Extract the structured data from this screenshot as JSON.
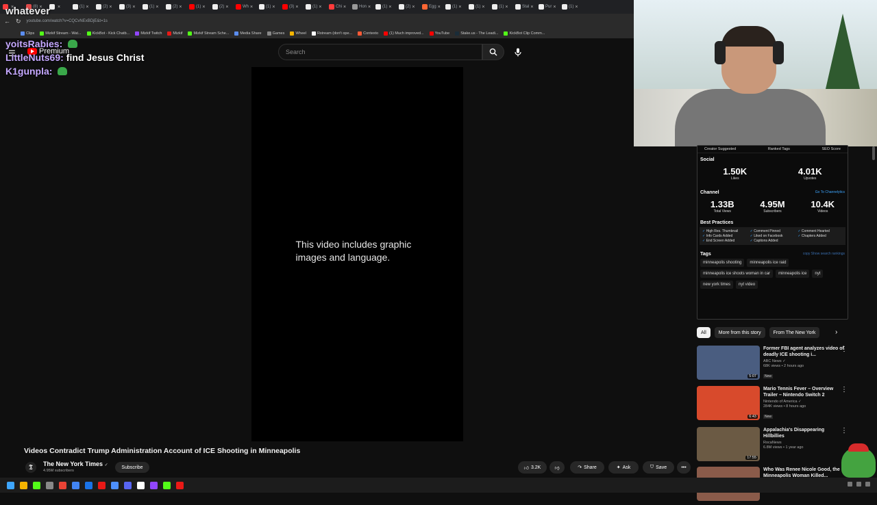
{
  "browser": {
    "tabs": [
      {
        "label": "",
        "color": "#ff3b3b"
      },
      {
        "label": "(8)",
        "color": "#e04a4a"
      },
      {
        "label": "",
        "color": "#eeeeee"
      },
      {
        "label": "(1)",
        "color": "#eeeeee"
      },
      {
        "label": "(2)",
        "color": "#eeeeee"
      },
      {
        "label": "(3)",
        "color": "#eeeeee"
      },
      {
        "label": "(1)",
        "color": "#eeeeee"
      },
      {
        "label": "(2)",
        "color": "#eeeeee"
      },
      {
        "label": "(1)",
        "color": "#ff0000"
      },
      {
        "label": "(2)",
        "color": "#eeeeee"
      },
      {
        "label": "Wh",
        "color": "#ff0000"
      },
      {
        "label": "(1)",
        "color": "#eeeeee"
      },
      {
        "label": "(3)",
        "color": "#ff0000"
      },
      {
        "label": "(1)",
        "color": "#eeeeee"
      },
      {
        "label": "Chi",
        "color": "#ff3b3b"
      },
      {
        "label": "Hon",
        "color": "#999999"
      },
      {
        "label": "(1)",
        "color": "#eeeeee"
      },
      {
        "label": "(2)",
        "color": "#eeeeee"
      },
      {
        "label": "Egg",
        "color": "#ff6633"
      },
      {
        "label": "(1)",
        "color": "#eeeeee"
      },
      {
        "label": "(1)",
        "color": "#eeeeee"
      },
      {
        "label": "(1)",
        "color": "#eeeeee"
      },
      {
        "label": "Stal",
        "color": "#eeeeee"
      },
      {
        "label": "Pur",
        "color": "#eeeeee"
      },
      {
        "label": "(1)",
        "color": "#eeeeee"
      }
    ],
    "url": "youtube.com/watch?v=CQCvNExBDjE&t=1s",
    "bookmarks": [
      {
        "label": "Clips",
        "color": "#5b8def"
      },
      {
        "label": "Mizkif Stream - Wat...",
        "color": "#53fc18"
      },
      {
        "label": "KickBot - Kick Chatb...",
        "color": "#53fc18"
      },
      {
        "label": "Mizkif Twitch",
        "color": "#9146ff"
      },
      {
        "label": "Mizkif",
        "color": "#e91916"
      },
      {
        "label": "Mizkif Stream Sche...",
        "color": "#53fc18"
      },
      {
        "label": "Media Share",
        "color": "#5b8def"
      },
      {
        "label": "Games",
        "color": "#888888"
      },
      {
        "label": "Wheel",
        "color": "#f4b400"
      },
      {
        "label": "Rstream (don't ope...",
        "color": "#ffffff"
      },
      {
        "label": "Contexto",
        "color": "#ff5a36"
      },
      {
        "label": "(1) Much improved...",
        "color": "#ff0000"
      },
      {
        "label": "YouTube",
        "color": "#ff0000"
      },
      {
        "label": "Stake.us - The Leadi...",
        "color": "#1a2c38"
      },
      {
        "label": "KickBot Clip Comm...",
        "color": "#53fc18"
      }
    ]
  },
  "overlay": {
    "top_text": "whatever",
    "chat": [
      {
        "user": "yoitsRabies:",
        "msg": "",
        "emote": true
      },
      {
        "user": "LittleNuts69:",
        "msg": "find Jesus Christ",
        "emote": false
      },
      {
        "user": "K1gunpla:",
        "msg": "",
        "emote": true
      }
    ]
  },
  "youtube": {
    "premium_label": "Premium",
    "search_placeholder": "Search",
    "video_message": "This video includes graphic images and language.",
    "title": "Videos Contradict Trump Administration Account of ICE Shooting in Minneapolis",
    "channel": {
      "name": "The New York Times",
      "subscribers": "4.95M subscribers",
      "logo": "𝕿",
      "verified": "✓"
    },
    "subscribe_label": "Subscribe",
    "actions": {
      "likes": "3.2K",
      "share": "Share",
      "ask": "Ask",
      "save": "Save"
    }
  },
  "seo_panel": {
    "tabs": [
      "Creator Suggested",
      "Ranked Tags",
      "SEO Score"
    ],
    "social_label": "Social",
    "social": [
      {
        "value": "1.50K",
        "label": "Likes"
      },
      {
        "value": "4.01K",
        "label": "Upvotes"
      }
    ],
    "channel_label": "Channel",
    "channel_link": "Go To Channelytics",
    "channel_stats": [
      {
        "value": "1.33B",
        "label": "Total Views"
      },
      {
        "value": "4.95M",
        "label": "Subscribers"
      },
      {
        "value": "10.4K",
        "label": "Videos"
      }
    ],
    "best_practices_label": "Best Practices",
    "best_practices": [
      "High Res. Thumbnail",
      "Comment Pinned",
      "Comment Hearted",
      "Info Cards Added",
      "Liked on Facebook",
      "Chapters Added",
      "End Screen Added",
      "Captions Added"
    ],
    "tags_label": "Tags",
    "tags_actions": "copy   Show search rankings",
    "tags": [
      "minneapolis shooting",
      "minneapolis ice raid",
      "minneapolis ice shoots woman in car",
      "minneapolis ice",
      "nyt",
      "new york times",
      "nyt video"
    ]
  },
  "chips": [
    "All",
    "More from this story",
    "From The New York"
  ],
  "recommendations": [
    {
      "title": "Former FBI agent analyzes video of deadly ICE shooting i...",
      "channel": "ABC News ✓",
      "meta": "68K views • 2 hours ago",
      "badge": "New",
      "duration": "5:07",
      "color": "#4a5d80"
    },
    {
      "title": "Mario Tennis Fever – Overview Trailer – Nintendo Switch 2",
      "channel": "Nintendo of America ✓",
      "meta": "284K views • 8 hours ago",
      "badge": "New",
      "duration": "6:43",
      "color": "#d84a2c"
    },
    {
      "title": "Appalachia's Disappearing Hillbillies",
      "channel": "RocaNews",
      "meta": "6.8M views • 1 year ago",
      "badge": "",
      "duration": "17:55",
      "color": "#6b5a44"
    },
    {
      "title": "Who Was Renee Nicole Good, the Minneapolis Woman Killed...",
      "channel": "",
      "meta": "",
      "badge": "",
      "duration": "",
      "color": "#8a5b4a"
    }
  ],
  "taskbar_colors": [
    "#3ea6ff",
    "#f4b400",
    "#53fc18",
    "#888888",
    "#ea4335",
    "#4285f4",
    "#1a73e8",
    "#e91916",
    "#4d90fe",
    "#5865f2",
    "#ffffff",
    "#9146ff",
    "#53fc18",
    "#e91916"
  ]
}
